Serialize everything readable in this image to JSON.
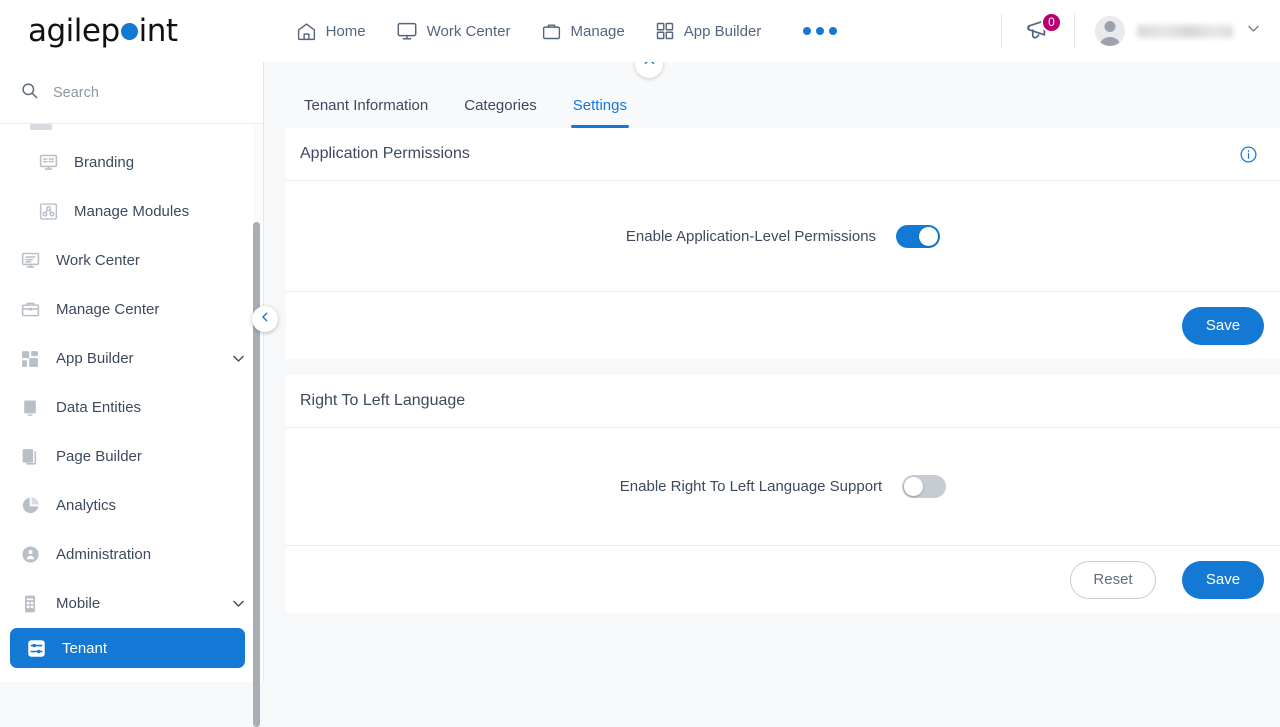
{
  "brand": {
    "name_part1": "agilep",
    "name_part2": "int",
    "accent": "#1479d4"
  },
  "header": {
    "nav": [
      {
        "label": "Home",
        "icon": "home-icon"
      },
      {
        "label": "Work Center",
        "icon": "monitor-icon"
      },
      {
        "label": "Manage",
        "icon": "briefcase-icon"
      },
      {
        "label": "App Builder",
        "icon": "grid-icon"
      }
    ],
    "more_label": "more-menu",
    "announcements": {
      "icon": "megaphone-icon",
      "badge_count": "0",
      "badge_color": "#b5006e"
    },
    "user": {
      "icon": "avatar-icon",
      "name": "",
      "chevron": "chevron-down-icon"
    }
  },
  "sidebar": {
    "search": {
      "placeholder": "Search",
      "value": "",
      "icon": "search-icon"
    },
    "items": [
      {
        "label": "Branding",
        "icon": "branding-icon",
        "sub": true,
        "expandable": false,
        "active": false
      },
      {
        "label": "Manage Modules",
        "icon": "modules-icon",
        "sub": true,
        "expandable": false,
        "active": false
      },
      {
        "label": "Work Center",
        "icon": "work-center-icon",
        "sub": false,
        "expandable": false,
        "active": false
      },
      {
        "label": "Manage Center",
        "icon": "manage-center-icon",
        "sub": false,
        "expandable": false,
        "active": false
      },
      {
        "label": "App Builder",
        "icon": "app-builder-icon",
        "sub": false,
        "expandable": true,
        "active": false
      },
      {
        "label": "Data Entities",
        "icon": "data-entities-icon",
        "sub": false,
        "expandable": false,
        "active": false
      },
      {
        "label": "Page Builder",
        "icon": "page-builder-icon",
        "sub": false,
        "expandable": false,
        "active": false
      },
      {
        "label": "Analytics",
        "icon": "analytics-icon",
        "sub": false,
        "expandable": false,
        "active": false
      },
      {
        "label": "Administration",
        "icon": "administration-icon",
        "sub": false,
        "expandable": false,
        "active": false
      },
      {
        "label": "Mobile",
        "icon": "mobile-icon",
        "sub": false,
        "expandable": true,
        "active": false
      },
      {
        "label": "Tenant",
        "icon": "tenant-icon",
        "sub": false,
        "expandable": false,
        "active": true
      }
    ],
    "collapse_icon": "chevron-left-icon"
  },
  "main": {
    "collapse_top_icon": "chevron-up-icon",
    "tabs": [
      {
        "label": "Tenant Information",
        "active": false
      },
      {
        "label": "Categories",
        "active": false
      },
      {
        "label": "Settings",
        "active": true
      }
    ],
    "cards": [
      {
        "title": "Application Permissions",
        "info_icon": "info-icon",
        "has_info": true,
        "field_label": "Enable Application-Level Permissions",
        "toggle_state": "on",
        "buttons": {
          "save": "Save",
          "reset": null
        }
      },
      {
        "title": "Right To Left Language",
        "info_icon": "",
        "has_info": false,
        "field_label": "Enable Right To Left Language Support",
        "toggle_state": "off",
        "buttons": {
          "save": "Save",
          "reset": "Reset"
        }
      }
    ]
  }
}
